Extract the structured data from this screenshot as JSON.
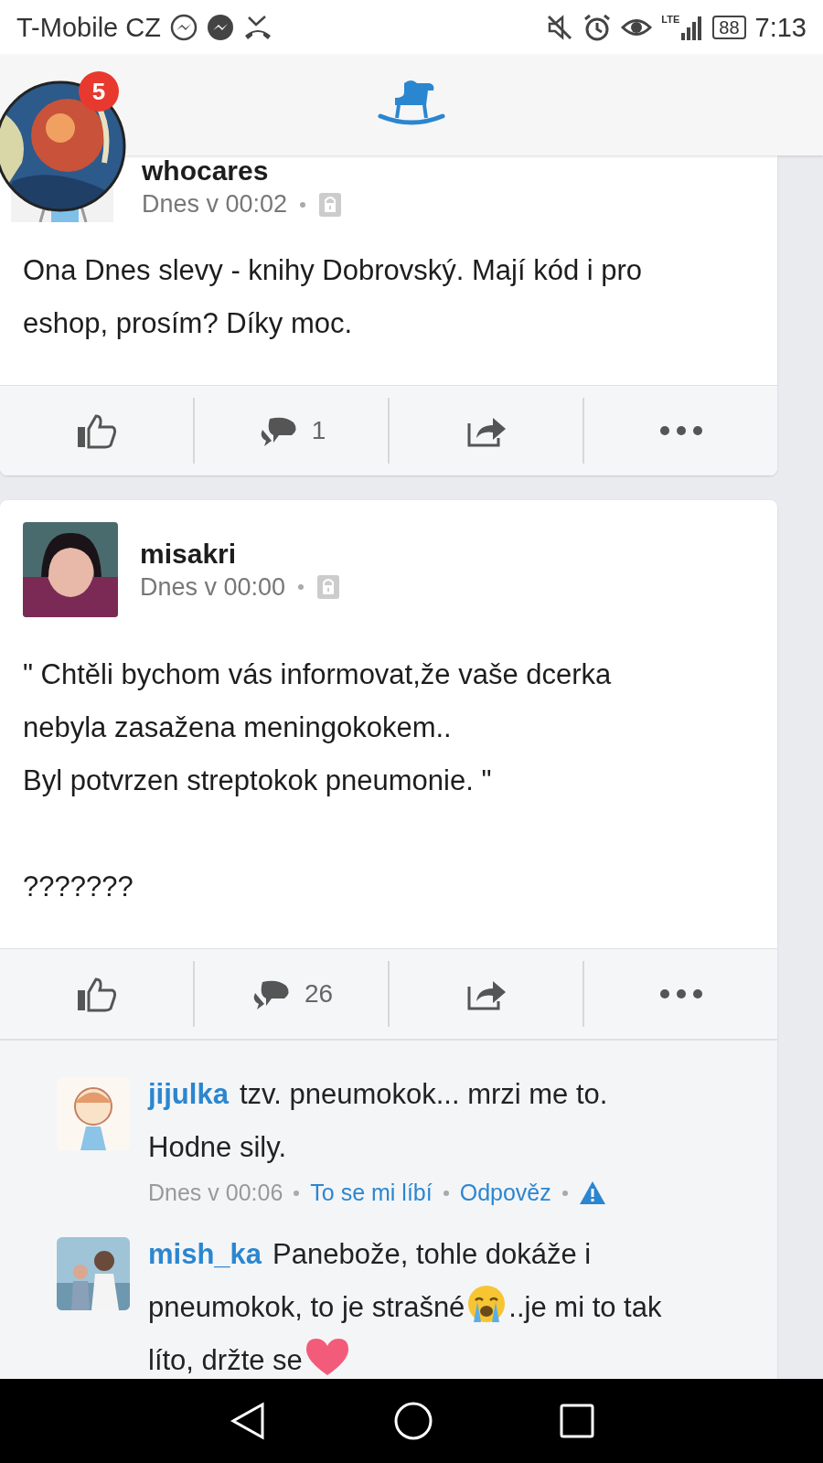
{
  "status_bar": {
    "carrier": "T-Mobile CZ",
    "network": "LTE",
    "battery": "88",
    "time": "7:13"
  },
  "header": {
    "notification_count": "5"
  },
  "posts": [
    {
      "author": "whocares",
      "time": "Dnes v 00:02",
      "text": "Ona Dnes slevy - knihy Dobrovský. Mají kód i pro eshop, prosím? Díky moc.",
      "comment_count": "1"
    },
    {
      "author": "misakri",
      "time": "Dnes v 00:00",
      "text": "\" Chtěli bychom vás informovat,že vaše dcerka nebyla zasažena meningokokem..\nByl potvrzen streptokok pneumonie. \"\n\n???????",
      "comment_count": "26",
      "comments": [
        {
          "author": "jijulka",
          "parts": [
            {
              "kind": "text",
              "text": "tzv. pneumokok... mrzi me to. Hodne sily."
            }
          ],
          "time": "Dnes v 00:06",
          "like": "To se mi líbí",
          "reply": "Odpověz"
        },
        {
          "author": "mish_ka",
          "parts": [
            {
              "kind": "text",
              "text": "Panebože, tohle dokáže i pneumokok, to je strašné"
            },
            {
              "kind": "crying"
            },
            {
              "kind": "text",
              "text": "..je mi to tak líto, držte se"
            },
            {
              "kind": "heart"
            }
          ]
        }
      ]
    }
  ]
}
